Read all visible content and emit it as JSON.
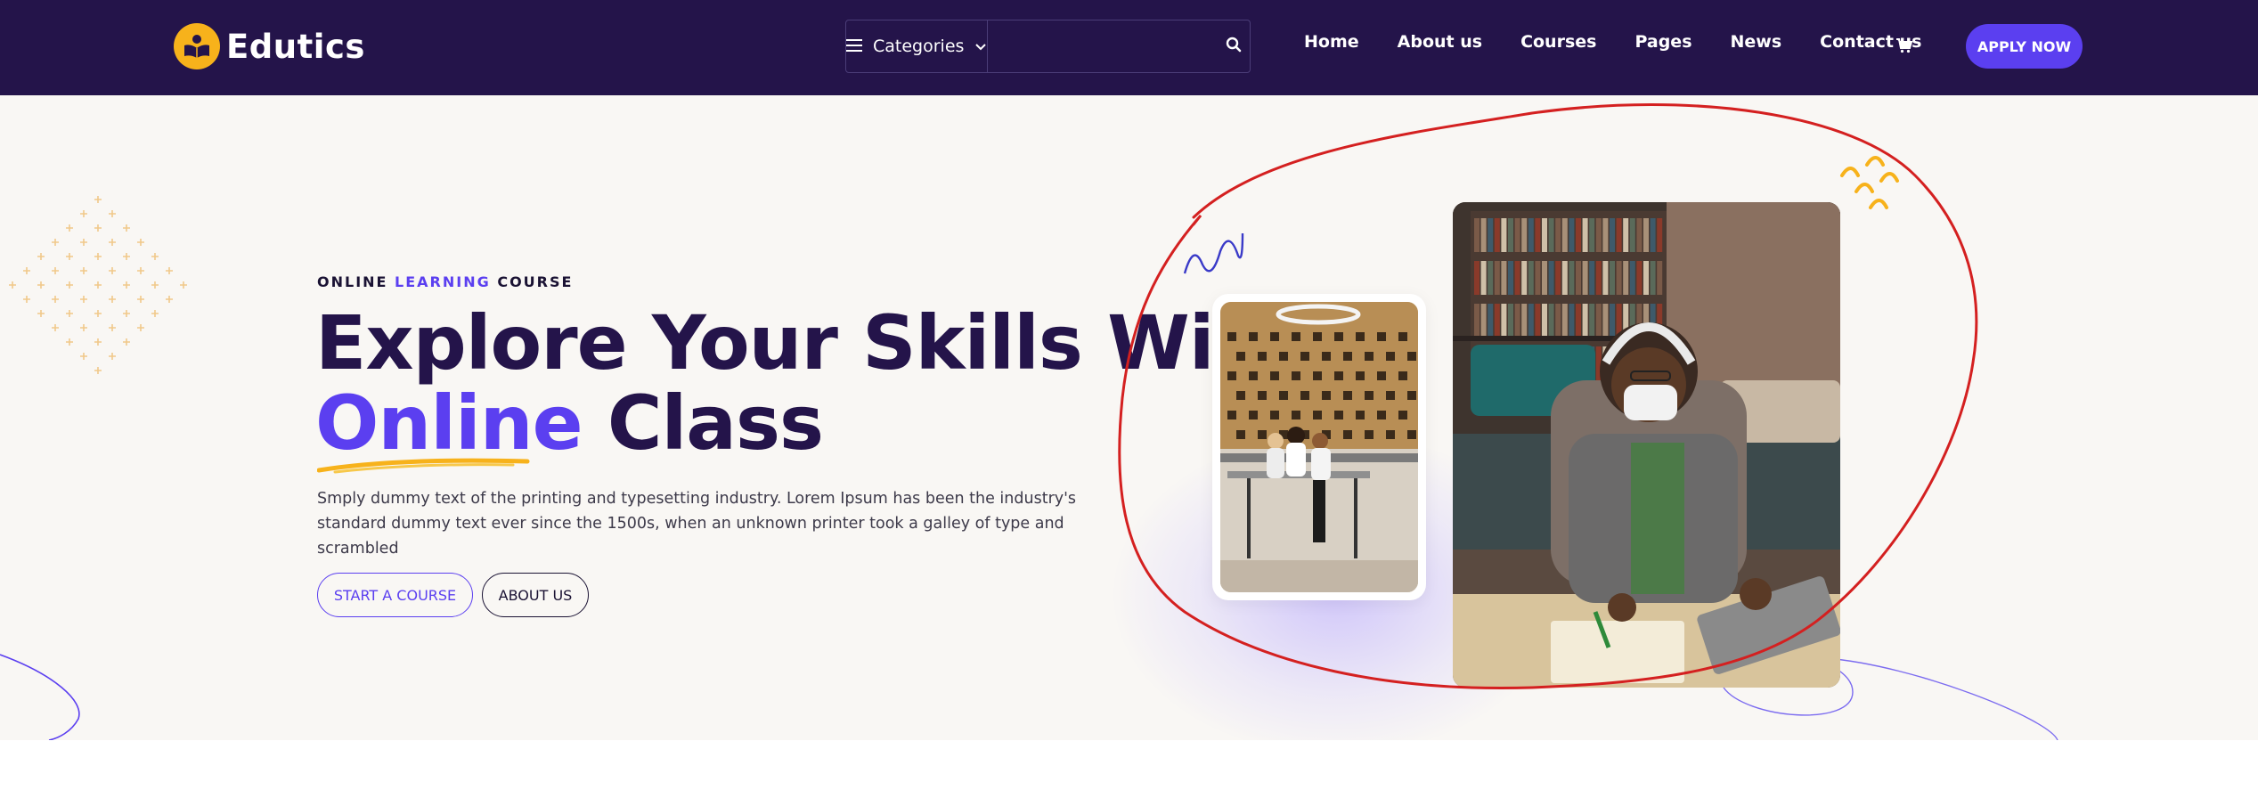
{
  "brand": {
    "name": "Edutics",
    "logo_icon": "book-reader-icon",
    "logo_color": "#f7b21b"
  },
  "colors": {
    "navbar_bg": "#24144a",
    "accent": "#5b3ff0",
    "yellow": "#f7b21b",
    "hero_bg": "#f9f7f4",
    "annotation": "#d42020"
  },
  "header": {
    "categories_label": "Categories",
    "search": {
      "placeholder": ""
    },
    "nav": [
      "Home",
      "About us",
      "Courses",
      "Pages",
      "News",
      "Contact us"
    ],
    "cart_icon": "cart-icon",
    "apply_label": "APPLY NOW"
  },
  "hero": {
    "eyebrow_part1": "ONLINE",
    "eyebrow_accent": "LEARNING",
    "eyebrow_part2": "COURSE",
    "headline_line1": "Explore Your Skills With",
    "headline_accent": "Online",
    "headline_end": "Class",
    "description": "Smply dummy text of the printing and typesetting industry. Lorem Ipsum has been the industry's standard dummy text ever since the 1500s, when an unknown printer took a galley of type and scrambled",
    "primary_button": "START A COURSE",
    "secondary_button": "ABOUT US"
  }
}
